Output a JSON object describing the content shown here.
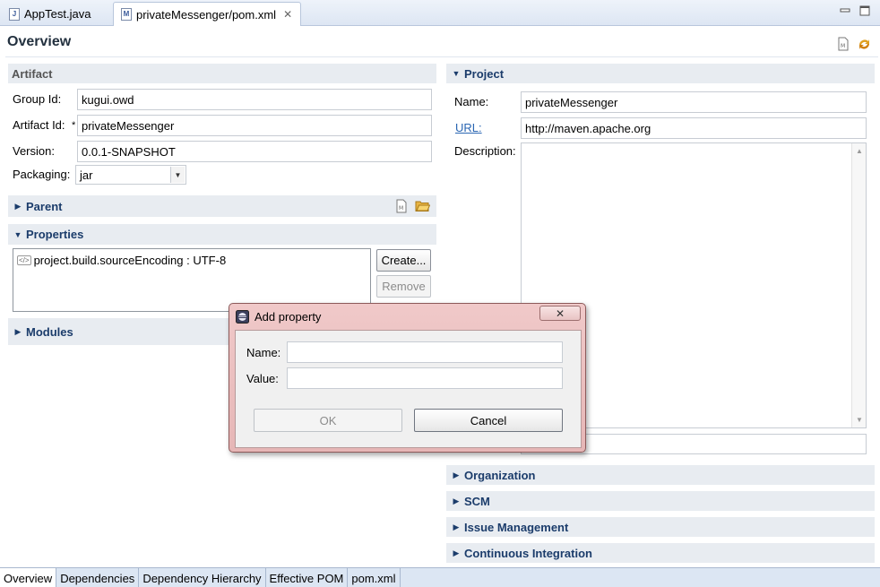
{
  "editor_tabs": [
    {
      "label": "AppTest.java",
      "icon": "java-file-icon"
    },
    {
      "label": "privateMessenger/pom.xml",
      "icon": "maven-pom-icon"
    }
  ],
  "page": {
    "title": "Overview"
  },
  "artifact": {
    "header": "Artifact",
    "group_id_label": "Group Id:",
    "group_id": "kugui.owd",
    "artifact_id_label": "Artifact Id:",
    "artifact_id_required": "*",
    "artifact_id": "privateMessenger",
    "version_label": "Version:",
    "version": "0.0.1-SNAPSHOT",
    "packaging_label": "Packaging:",
    "packaging": "jar"
  },
  "parent": {
    "header": "Parent"
  },
  "properties": {
    "header": "Properties",
    "items": [
      "project.build.sourceEncoding : UTF-8"
    ],
    "create_label": "Create...",
    "remove_label": "Remove"
  },
  "modules": {
    "header": "Modules"
  },
  "project": {
    "header": "Project",
    "name_label": "Name:",
    "name": "privateMessenger",
    "url_label": "URL:",
    "url": "http://maven.apache.org",
    "description_label": "Description:",
    "description": ""
  },
  "collapsed_sections": [
    "Organization",
    "SCM",
    "Issue Management",
    "Continuous Integration"
  ],
  "bottom_tabs": [
    "Overview",
    "Dependencies",
    "Dependency Hierarchy",
    "Effective POM",
    "pom.xml"
  ],
  "dialog": {
    "title": "Add property",
    "name_label": "Name:",
    "name_value": "",
    "value_label": "Value:",
    "value_value": "",
    "ok_label": "OK",
    "cancel_label": "Cancel"
  }
}
